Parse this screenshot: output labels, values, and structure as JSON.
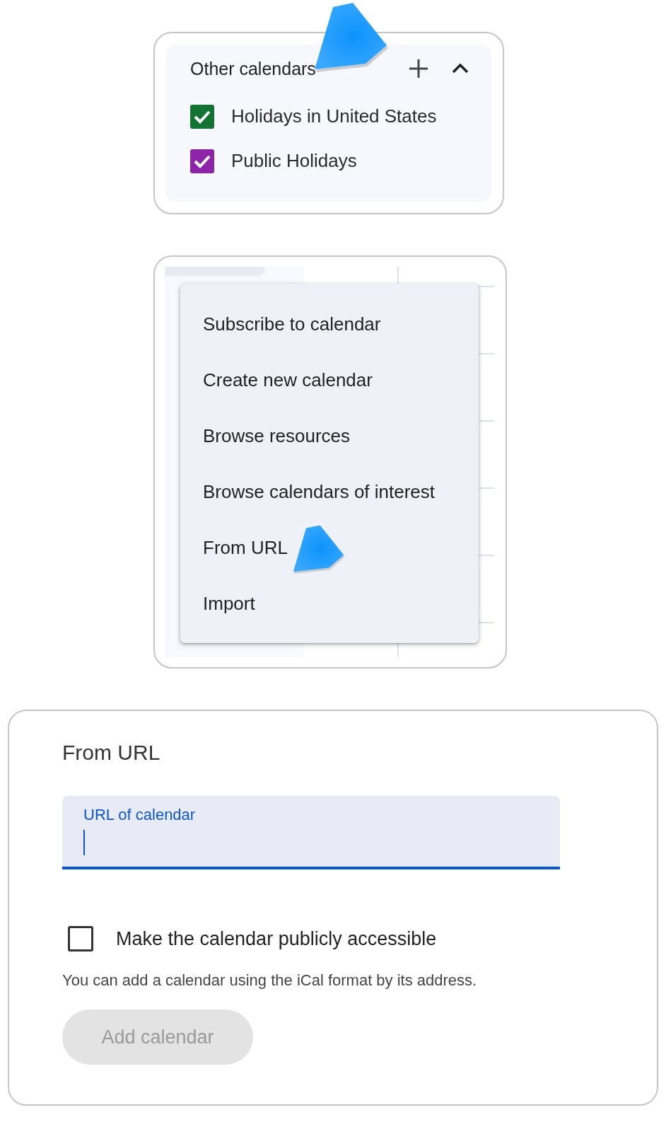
{
  "other_calendars": {
    "title": "Other calendars",
    "expanded": true,
    "calendars": [
      {
        "name": "Holidays in United States",
        "checked": true,
        "color": "#137333"
      },
      {
        "name": "Public Holidays",
        "checked": true,
        "color": "#8e24aa"
      }
    ]
  },
  "add_menu": {
    "items": [
      {
        "label": "Subscribe to calendar"
      },
      {
        "label": "Create new calendar"
      },
      {
        "label": "Browse resources"
      },
      {
        "label": "Browse calendars of interest"
      },
      {
        "label": "From URL"
      },
      {
        "label": "Import"
      }
    ]
  },
  "from_url": {
    "title": "From URL",
    "url_field": {
      "label": "URL of calendar",
      "focused": true
    },
    "public_checkbox": {
      "label": "Make the calendar publicly accessible",
      "checked": false
    },
    "hint": "You can add a calendar using the iCal format by its address.",
    "add_button": {
      "label": "Add calendar",
      "disabled": true
    }
  }
}
